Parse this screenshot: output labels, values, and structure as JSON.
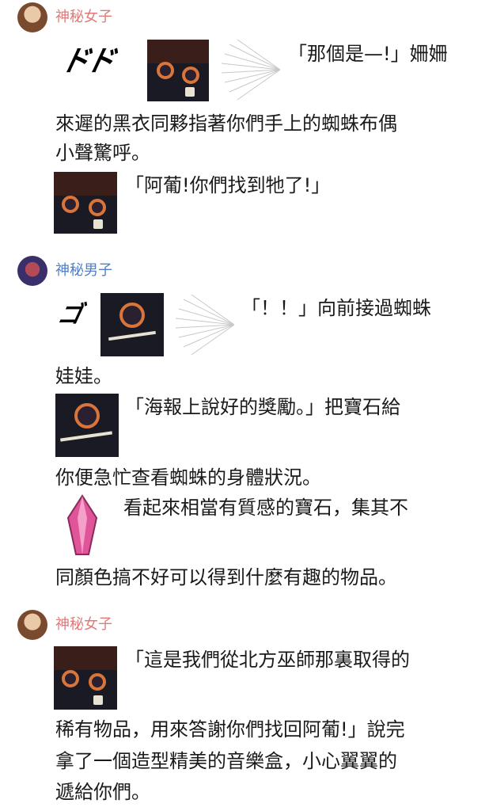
{
  "messages": [
    {
      "sender": "神秘女子",
      "avatar_icon": "female-avatar-icon",
      "sound_effect": "ドド",
      "line1": "「那個是—!」姍姍",
      "line2": "來遲的黑衣同夥指著你們手上的蜘蛛布偶",
      "line3": "小聲驚呼。",
      "line4": "「阿葡!你們找到牠了!」"
    },
    {
      "sender": "神秘男子",
      "avatar_icon": "male-avatar-icon",
      "sound_effect": "ゴ",
      "line1": "「！！」向前接過蜘蛛",
      "line2": "娃娃。",
      "line3": "「海報上說好的獎勵。」把寶石給",
      "line4": "你便急忙查看蜘蛛的身體狀況。",
      "line5": "看起來相當有質感的寶石，集其不",
      "line6": "同顏色搞不好可以得到什麼有趣的物品。"
    },
    {
      "sender": "神秘女子",
      "avatar_icon": "female-avatar-icon",
      "line1": "「這是我們從北方巫師那裏取得的",
      "line2": "稀有物品，用來答謝你們找回阿葡!」說完",
      "line3": "拿了一個造型精美的音樂盒，小心翼翼的",
      "line4": "遞給你們。"
    }
  ],
  "colors": {
    "female_name": "#e07a7a",
    "male_name": "#4f7fc8",
    "text": "#1a1a1a",
    "gem": "#e0559a"
  }
}
